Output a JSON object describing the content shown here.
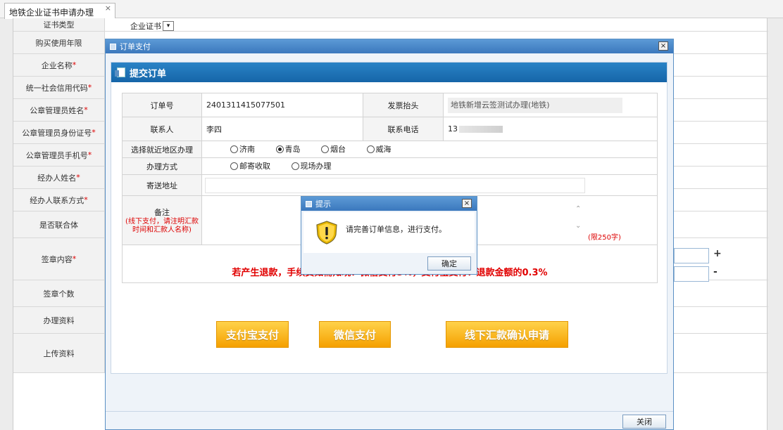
{
  "tab": {
    "label": "地铁企业证书申请办理",
    "close": "×"
  },
  "background_form": {
    "rows": [
      {
        "label": "证书类型",
        "required": false
      },
      {
        "label": "购买使用年限",
        "required": false
      },
      {
        "label": "企业名称",
        "required": true
      },
      {
        "label": "统一社会信用代码",
        "required": true
      },
      {
        "label": "公章管理员姓名",
        "required": true
      },
      {
        "label": "公章管理员身份证号",
        "required": true
      },
      {
        "label": "公章管理员手机号",
        "required": true
      },
      {
        "label": "经办人姓名",
        "required": true
      },
      {
        "label": "经办人联系方式",
        "required": true
      },
      {
        "label": "是否联合体",
        "required": false
      },
      {
        "label": "签章内容",
        "required": true
      },
      {
        "label": "签章个数",
        "required": false
      },
      {
        "label": "办理资料",
        "required": false
      },
      {
        "label": "上传资料",
        "required": false
      }
    ],
    "required_mark": "*",
    "cert_type_value": "企业证书",
    "plus": "+",
    "minus": "-"
  },
  "modal": {
    "title": "订单支付",
    "close": "×",
    "section_header": "提交订单",
    "order_no_label": "订单号",
    "order_no": "2401311415077501",
    "invoice_label": "发票抬头",
    "invoice_value": "地铁新增云签测试办理(地铁)",
    "contact_label": "联系人",
    "contact_value": "李四",
    "phone_label": "联系电话",
    "phone_value": "13",
    "region_label": "选择就近地区办理",
    "regions": [
      {
        "label": "济南",
        "checked": false
      },
      {
        "label": "青岛",
        "checked": true
      },
      {
        "label": "烟台",
        "checked": false
      },
      {
        "label": "威海",
        "checked": false
      }
    ],
    "method_label": "办理方式",
    "methods": [
      {
        "label": "邮寄收取",
        "checked": false
      },
      {
        "label": "现场办理",
        "checked": false
      }
    ],
    "address_label": "寄送地址",
    "address_value": "",
    "remark_label": "备注",
    "remark_sub": "(线下支付，请注明汇款时间和汇款人名称)",
    "remark_limit": "(限250字)",
    "refund_note": "若产生退款，手续费如需知晓：微信支付5%，支付宝支付：退款金额的0.3%",
    "buttons": {
      "alipay": "支付宝支付",
      "wechat": "微信支付",
      "offline": "线下汇款确认申请"
    },
    "close_button": "关闭"
  },
  "alert": {
    "title": "提示",
    "close": "×",
    "message": "请完善订单信息，进行支付。",
    "ok": "确定",
    "icon": "warning-shield-icon"
  }
}
